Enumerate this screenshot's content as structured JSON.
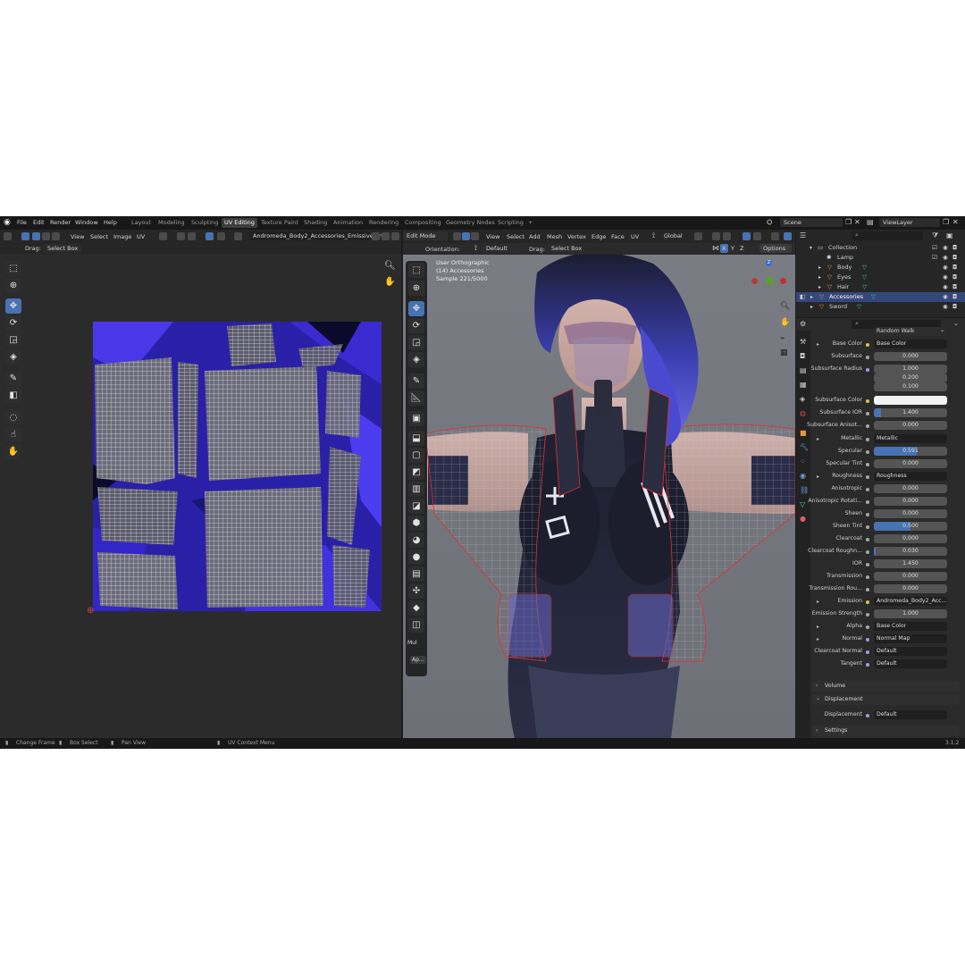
{
  "topbar": {
    "menus": [
      "File",
      "Edit",
      "Render",
      "Window",
      "Help"
    ],
    "workspaces": [
      "Layout",
      "Modeling",
      "Sculpting",
      "UV Editing",
      "Texture Paint",
      "Shading",
      "Animation",
      "Rendering",
      "Compositing",
      "Geometry Nodes",
      "Scripting"
    ],
    "active_workspace": "UV Editing",
    "add_tab": "+",
    "scene": "Scene",
    "view_layer": "ViewLayer"
  },
  "uv_editor": {
    "menus": [
      "View",
      "Select",
      "Image",
      "UV"
    ],
    "image_name": "Andromeda_Body2_Accessories_Emissive.png",
    "drag_label": "Drag:",
    "drag_value": "Select Box"
  },
  "viewport": {
    "mode": "Edit Mode",
    "menus": [
      "View",
      "Select",
      "Add",
      "Mesh",
      "Vertex",
      "Edge",
      "Face",
      "UV"
    ],
    "transform_orientation": "Global",
    "orientation_label": "Orientation:",
    "orientation_value": "Default",
    "drag_label": "Drag:",
    "drag_value": "Select Box",
    "options_label": "Options",
    "axes": [
      "X",
      "Y",
      "Z"
    ],
    "overlay_line1": "User Orthographic",
    "overlay_line2": "(14) Accessories",
    "overlay_line3": "Sample 221/5000",
    "gizmo_z": "Z",
    "last_op_panel": "Mul",
    "last_op_sub": "Ap..."
  },
  "outliner": {
    "rows": [
      {
        "label": "Collection",
        "depth": 0
      },
      {
        "label": "Lamp",
        "depth": 1
      },
      {
        "label": "Body",
        "depth": 1
      },
      {
        "label": "Eyes",
        "depth": 1
      },
      {
        "label": "Hair",
        "depth": 1
      },
      {
        "label": "Accessories",
        "depth": 1,
        "selected": true
      },
      {
        "label": "Sword",
        "depth": 1
      }
    ]
  },
  "properties": {
    "subsurface_method": "Random Walk",
    "rows": [
      {
        "label": "Base Color",
        "value": "Base Color",
        "kind": "link",
        "expand": true,
        "dot": "yel"
      },
      {
        "label": "Subsurface",
        "value": "0.000",
        "kind": "num",
        "fill": 0
      },
      {
        "label": "Subsurface Radius",
        "value": "1.000",
        "kind": "num",
        "fill": 0,
        "dot": "blue"
      },
      {
        "label": "",
        "value": "0.200",
        "kind": "num",
        "fill": 0,
        "nodot": true
      },
      {
        "label": "",
        "value": "0.100",
        "kind": "num",
        "fill": 0,
        "nodot": true
      },
      {
        "label": "Subsurface Color",
        "value": "",
        "kind": "color",
        "dot": "yel"
      },
      {
        "label": "Subsurface IOR",
        "value": "1.400",
        "kind": "num",
        "fill": 0.1
      },
      {
        "label": "Subsurface Anisot...",
        "value": "0.000",
        "kind": "num",
        "fill": 0
      },
      {
        "label": "Metallic",
        "value": "Metallic",
        "kind": "link",
        "expand": true
      },
      {
        "label": "Specular",
        "value": "0.591",
        "kind": "num",
        "fill": 0.591
      },
      {
        "label": "Specular Tint",
        "value": "0.000",
        "kind": "num",
        "fill": 0
      },
      {
        "label": "Roughness",
        "value": "Roughness",
        "kind": "link",
        "expand": true
      },
      {
        "label": "Anisotropic",
        "value": "0.000",
        "kind": "num",
        "fill": 0
      },
      {
        "label": "Anisotropic Rotati...",
        "value": "0.000",
        "kind": "num",
        "fill": 0
      },
      {
        "label": "Sheen",
        "value": "0.000",
        "kind": "num",
        "fill": 0
      },
      {
        "label": "Sheen Tint",
        "value": "0.500",
        "kind": "num",
        "fill": 0.5
      },
      {
        "label": "Clearcoat",
        "value": "0.000",
        "kind": "num",
        "fill": 0
      },
      {
        "label": "Clearcoat Roughn...",
        "value": "0.030",
        "kind": "num",
        "fill": 0.03
      },
      {
        "label": "IOR",
        "value": "1.450",
        "kind": "num",
        "fill": 0
      },
      {
        "label": "Transmission",
        "value": "0.000",
        "kind": "num",
        "fill": 0
      },
      {
        "label": "Transmission Rou...",
        "value": "0.000",
        "kind": "num",
        "fill": 0
      },
      {
        "label": "Emission",
        "value": "Andromeda_Body2_Acc...",
        "kind": "link",
        "expand": true,
        "dot": "yel"
      },
      {
        "label": "Emission Strength",
        "value": "1.000",
        "kind": "num",
        "fill": 0
      },
      {
        "label": "Alpha",
        "value": "Base Color",
        "kind": "link",
        "expand": true
      },
      {
        "label": "Normal",
        "value": "Normal Map",
        "kind": "link",
        "expand": true,
        "dot": "blue"
      },
      {
        "label": "Clearcoat Normal",
        "value": "Default",
        "kind": "link",
        "dot": "blue"
      },
      {
        "label": "Tangent",
        "value": "Default",
        "kind": "link",
        "dot": "blue"
      }
    ],
    "panel_volume": "Volume",
    "panel_displacement": "Displacement",
    "displacement_label": "Displacement",
    "displacement_value": "Default",
    "panel_settings": "Settings"
  },
  "statusbar": {
    "items": [
      "Change Frame",
      "Box Select",
      "Pan View",
      "UV Context Menu"
    ],
    "version": "3.1.2"
  },
  "colors": {
    "accent": "#4772b3",
    "uv_background": "#3b2bd6",
    "wire_red": "#e03030"
  }
}
